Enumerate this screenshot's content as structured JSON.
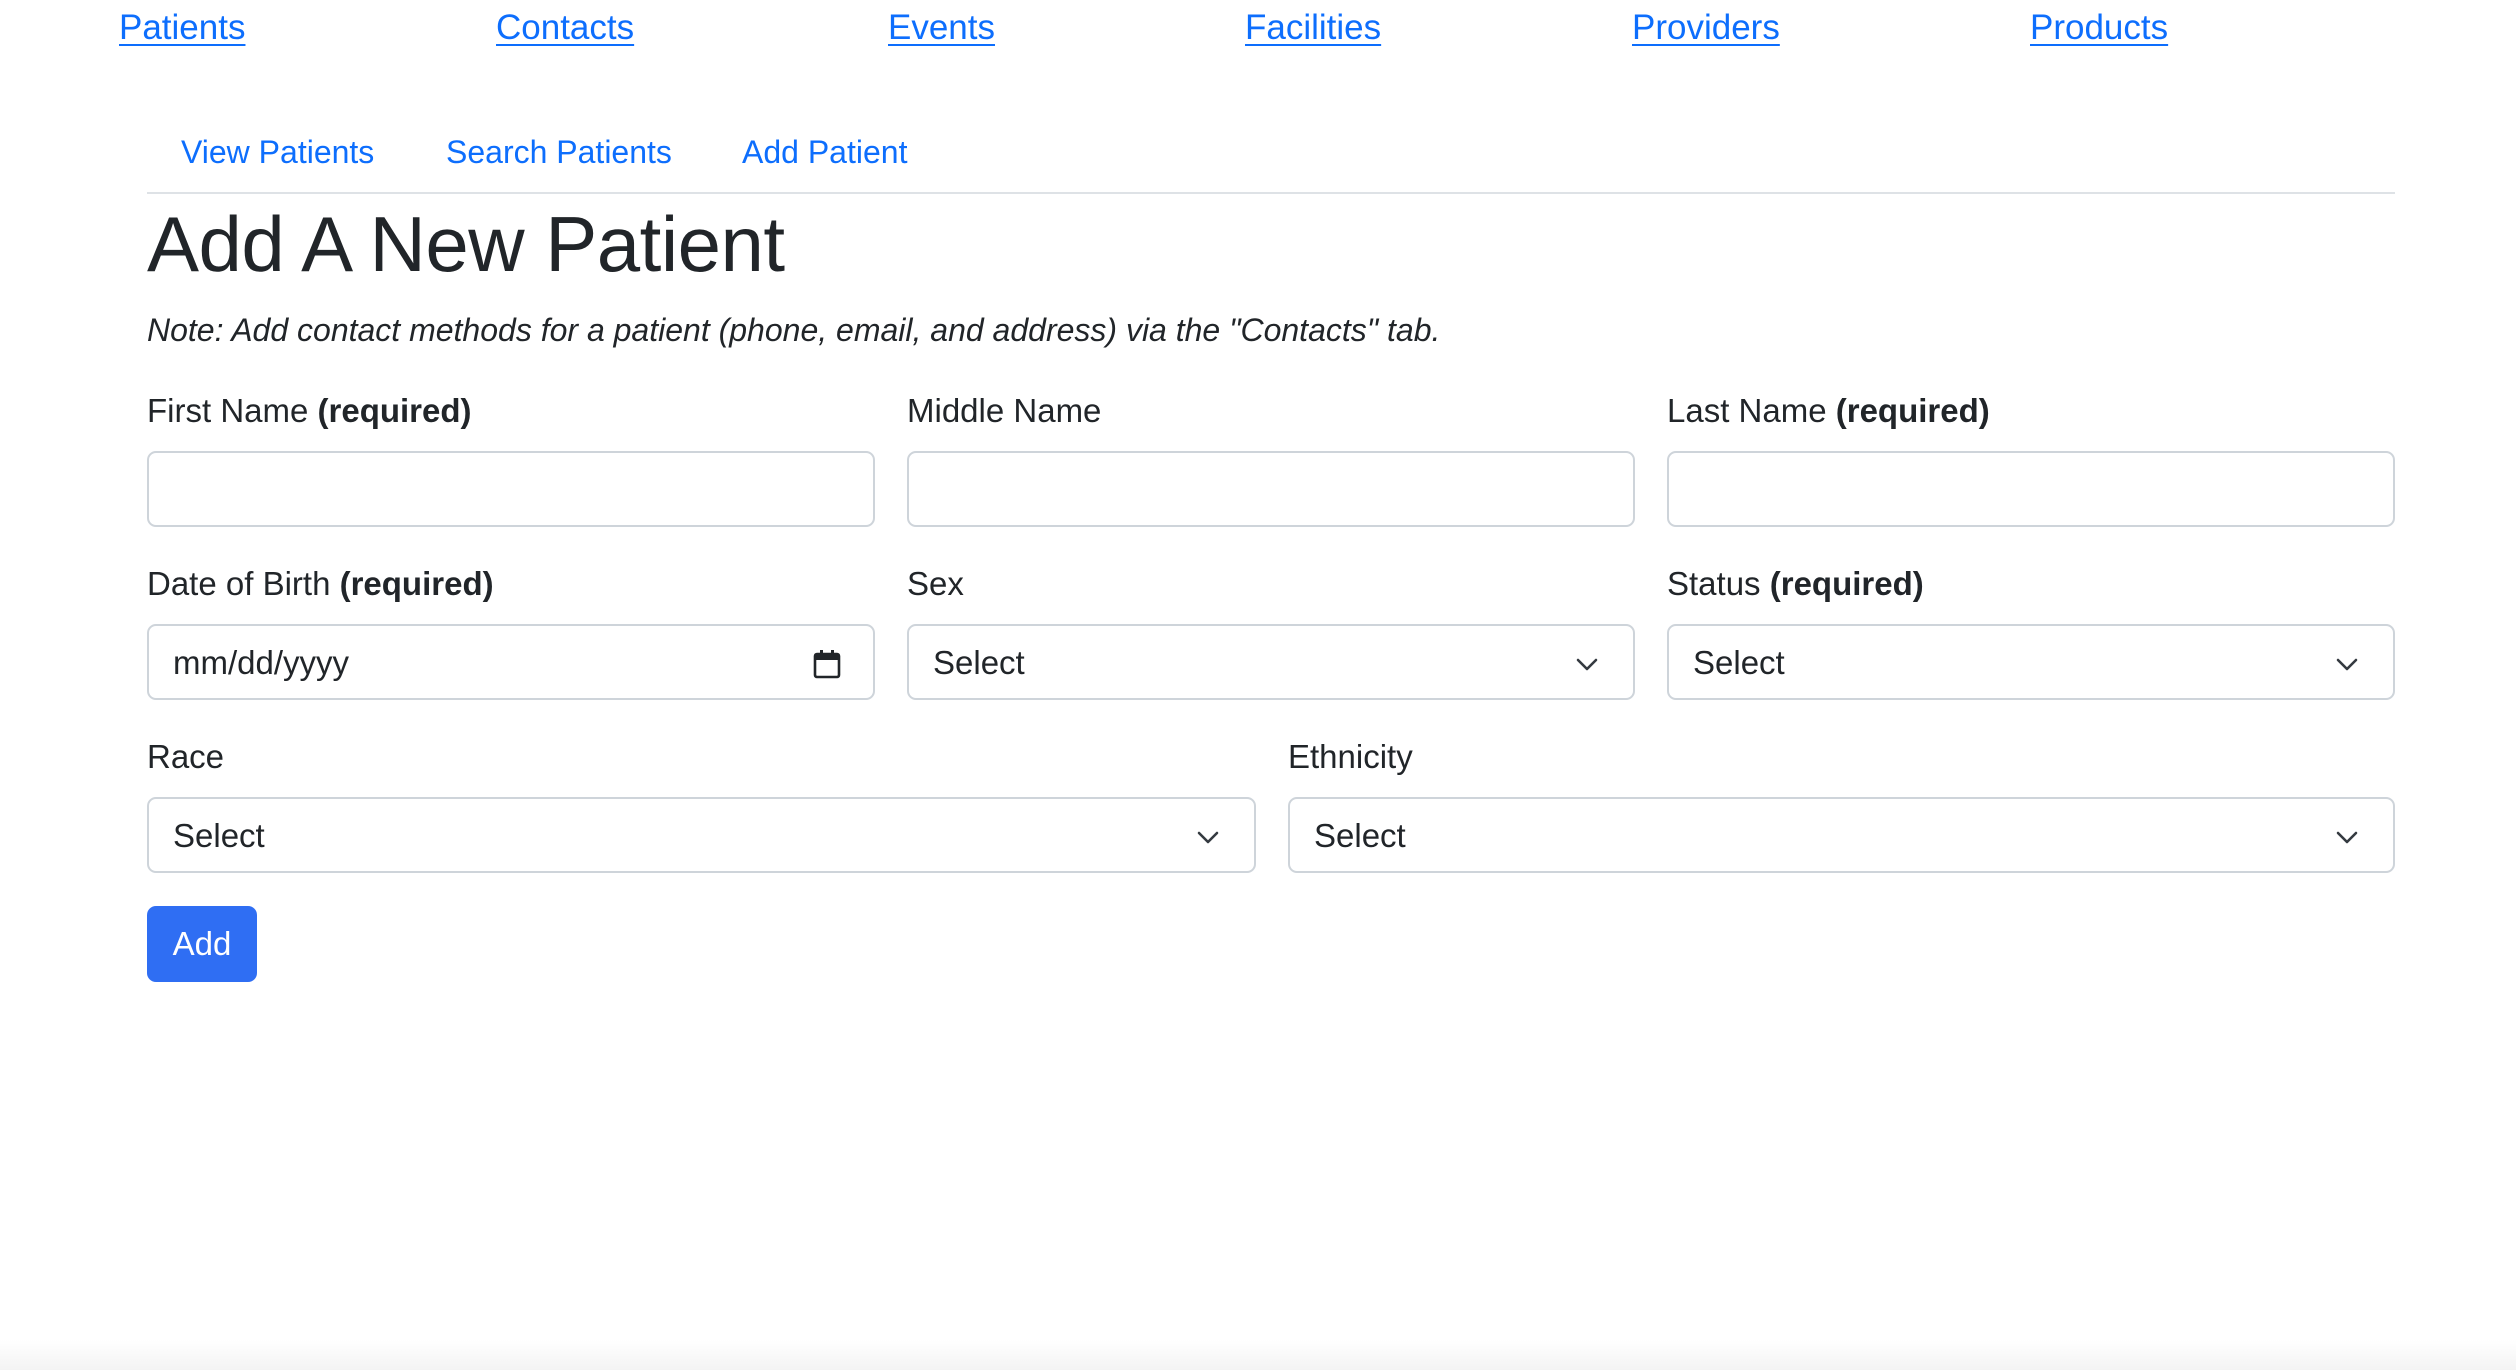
{
  "top_nav": {
    "items": [
      {
        "label": "Patients"
      },
      {
        "label": "Contacts"
      },
      {
        "label": "Events"
      },
      {
        "label": "Facilities"
      },
      {
        "label": "Providers"
      },
      {
        "label": "Products"
      }
    ]
  },
  "sub_tabs": {
    "items": [
      {
        "label": "View Patients"
      },
      {
        "label": "Search Patients"
      },
      {
        "label": "Add Patient"
      }
    ]
  },
  "page": {
    "title": "Add A New Patient",
    "note": "Note: Add contact methods for a patient (phone, email, and address) via the \"Contacts\" tab."
  },
  "form": {
    "required_marker": "(required)",
    "first_name": {
      "label": "First Name",
      "value": ""
    },
    "middle_name": {
      "label": "Middle Name",
      "value": ""
    },
    "last_name": {
      "label": "Last Name",
      "value": ""
    },
    "date_of_birth": {
      "label": "Date of Birth",
      "placeholder": "mm/dd/yyyy"
    },
    "sex": {
      "label": "Sex",
      "selected": "Select"
    },
    "status": {
      "label": "Status",
      "selected": "Select"
    },
    "race": {
      "label": "Race",
      "selected": "Select"
    },
    "ethnicity": {
      "label": "Ethnicity",
      "selected": "Select"
    },
    "submit_label": "Add"
  },
  "colors": {
    "link": "#0d6efd",
    "primary_button": "#2f6ef3",
    "border": "#ced4da",
    "text": "#212529"
  }
}
